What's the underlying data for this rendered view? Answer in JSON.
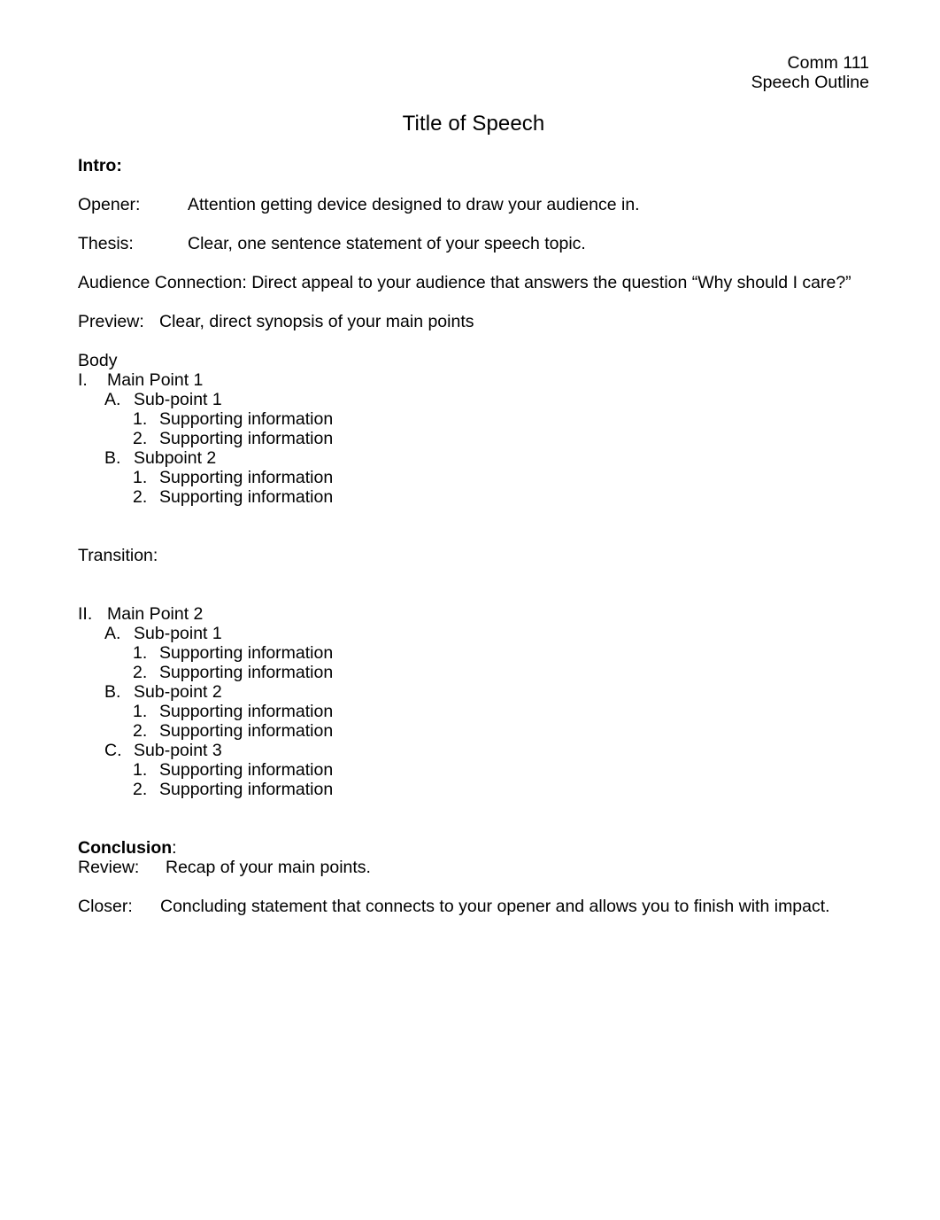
{
  "header": {
    "course": "Comm 111",
    "doc_type": "Speech Outline"
  },
  "title": "Title of Speech",
  "intro": {
    "heading": "Intro:",
    "rows": [
      {
        "label": "Opener:",
        "value": "Attention getting device designed to draw your audience in."
      },
      {
        "label": "Thesis:",
        "value": "Clear, one sentence statement of your speech topic."
      }
    ],
    "audience_connection": "Audience Connection: Direct appeal to your audience that answers the question “Why should I care?”",
    "preview_label": "Preview:",
    "preview_value": "Clear, direct synopsis of your main points"
  },
  "body": {
    "heading": "Body",
    "main_points": [
      {
        "marker": "I.",
        "label": "Main Point 1",
        "subpoints": [
          {
            "marker": "A.",
            "label": "Sub-point 1",
            "support": [
              {
                "marker": "1.",
                "label": "Supporting information"
              },
              {
                "marker": "2.",
                "label": "Supporting information"
              }
            ]
          },
          {
            "marker": "B.",
            "label": "Subpoint 2",
            "support": [
              {
                "marker": "1.",
                "label": "Supporting information"
              },
              {
                "marker": "2.",
                "label": "Supporting information"
              }
            ]
          }
        ]
      },
      {
        "marker": "II.",
        "label": "Main Point 2",
        "subpoints": [
          {
            "marker": "A.",
            "label": "Sub-point 1",
            "support": [
              {
                "marker": "1.",
                "label": "Supporting information"
              },
              {
                "marker": "2.",
                "label": "Supporting information"
              }
            ]
          },
          {
            "marker": "B.",
            "label": "Sub-point 2",
            "support": [
              {
                "marker": "1.",
                "label": "Supporting information"
              },
              {
                "marker": "2.",
                "label": "Supporting information"
              }
            ]
          },
          {
            "marker": "C.",
            "label": "Sub-point 3",
            "support": [
              {
                "marker": "1.",
                "label": "Supporting information"
              },
              {
                "marker": "2.",
                "label": "Supporting information"
              }
            ]
          }
        ]
      }
    ],
    "transition_label": "Transition:"
  },
  "conclusion": {
    "heading_bold": "Conclusion",
    "heading_colon": ":",
    "rows": [
      {
        "label": "Review:",
        "value": "Recap of your main points."
      },
      {
        "label": "Closer:",
        "value": "Concluding statement that connects to your opener and allows you to finish with impact."
      }
    ]
  }
}
